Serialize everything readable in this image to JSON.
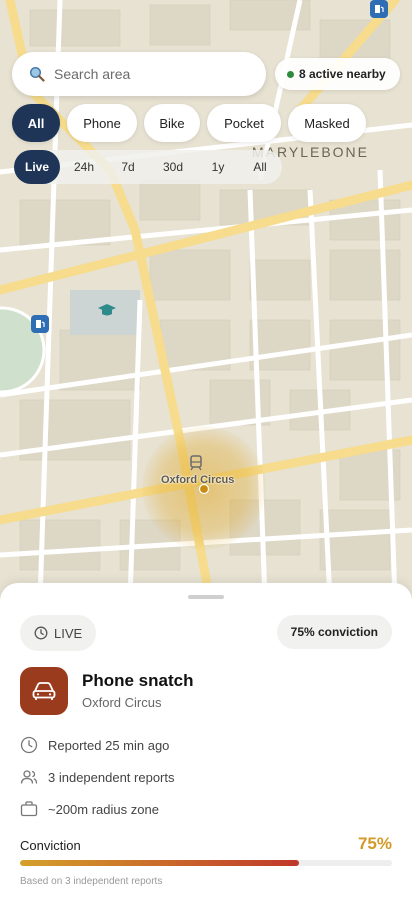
{
  "search": {
    "placeholder": "Search area",
    "icon": "search-icon"
  },
  "status": {
    "active_nearby": "8 active nearby",
    "dot_color": "#2e8b3e"
  },
  "filters": {
    "categories": [
      {
        "label": "All",
        "active": true
      },
      {
        "label": "Phone",
        "active": false
      },
      {
        "label": "Bike",
        "active": false
      },
      {
        "label": "Pocket",
        "active": false
      },
      {
        "label": "Masked",
        "active": false
      }
    ],
    "time_ranges": [
      {
        "label": "Live",
        "active": true
      },
      {
        "label": "24h",
        "active": false
      },
      {
        "label": "7d",
        "active": false
      },
      {
        "label": "30d",
        "active": false
      },
      {
        "label": "1y",
        "active": false
      },
      {
        "label": "All",
        "active": false
      }
    ]
  },
  "map": {
    "district_label": "MARYLEBONE",
    "place_label": "Oxford Circus",
    "icons": [
      "fuel-station-icon",
      "university-icon",
      "station-icon"
    ]
  },
  "incident": {
    "live_label": "LIVE",
    "conviction_badge": "75% conviction",
    "category_icon": "car-icon",
    "category_color": "#9b3b1d",
    "title": "Phone snatch",
    "location": "Oxford Circus",
    "reported": "Reported 25 min ago",
    "reports": "3 independent reports",
    "radius": "~200m radius zone",
    "conviction_label": "Conviction",
    "conviction_value": "75%",
    "conviction_fraction": 0.75,
    "based_on": "Based on 3 independent reports"
  },
  "colors": {
    "accent": "#1e3557",
    "conviction": "#d39a26"
  }
}
